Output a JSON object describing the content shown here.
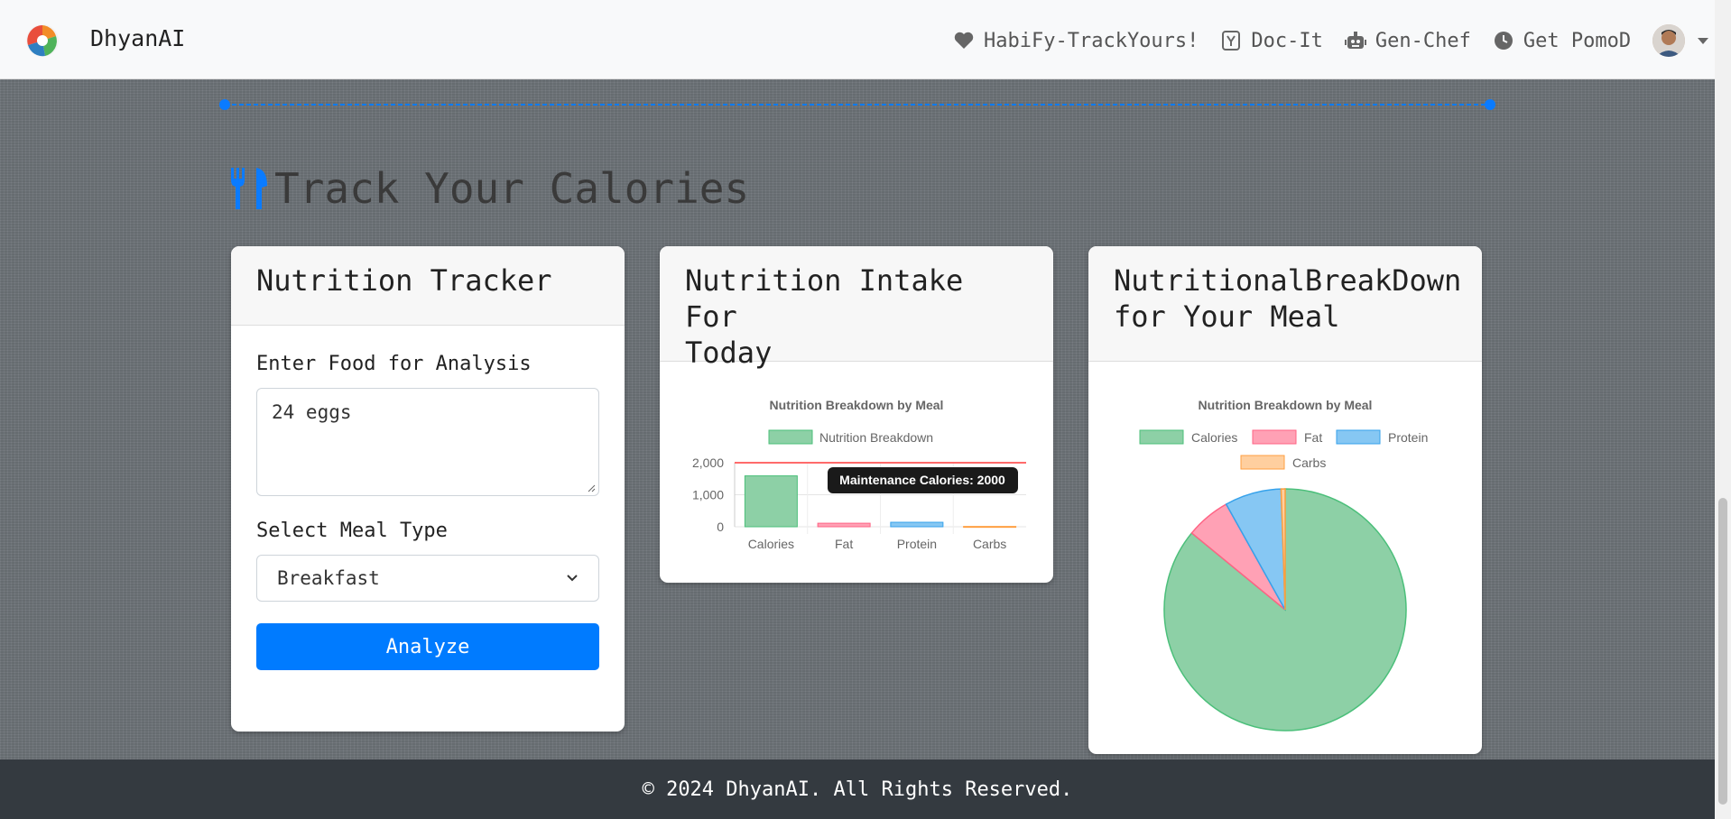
{
  "nav": {
    "brand": "DhyanAI",
    "items": [
      {
        "label": "HabiFy-TrackYours!",
        "icon": "heart-icon"
      },
      {
        "label": "Doc-It",
        "icon": "yahoo-icon"
      },
      {
        "label": "Gen-Chef",
        "icon": "robot-icon"
      },
      {
        "label": "Get PomoD",
        "icon": "clock-icon"
      }
    ]
  },
  "page": {
    "heading": "Track Your Calories"
  },
  "tracker": {
    "title": "Nutrition Tracker",
    "food_label": "Enter Food for Analysis",
    "food_value": "24 eggs",
    "meal_label": "Select Meal Type",
    "meal_value": "Breakfast",
    "analyze_label": "Analyze"
  },
  "intake_card": {
    "title_line1": "Nutrition Intake For",
    "title_line2": "Today"
  },
  "breakdown_card": {
    "title_line1": "NutritionalBreakDown",
    "title_line2": "for Your Meal"
  },
  "footer": {
    "text": "© 2024 DhyanAI. All Rights Reserved."
  },
  "colors": {
    "primary": "#007bff",
    "green": "#8dd0a6",
    "pink": "#ffa1b5",
    "blue": "#86c7f3",
    "orange": "#ffcf9f"
  },
  "chart_data": [
    {
      "type": "bar",
      "title": "Nutrition Breakdown by Meal",
      "categories": [
        "Calories",
        "Fat",
        "Protein",
        "Carbs"
      ],
      "series": [
        {
          "name": "Nutrition Breakdown",
          "values": [
            1590,
            110,
            140,
            10
          ]
        }
      ],
      "ylim": [
        0,
        2000
      ],
      "yticks": [
        "0",
        "1,000",
        "2,000"
      ],
      "annotation": {
        "value": 2000,
        "label": "Maintenance Calories: 2000"
      }
    },
    {
      "type": "pie",
      "title": "Nutrition Breakdown by Meal",
      "labels": [
        "Calories",
        "Fat",
        "Protein",
        "Carbs"
      ],
      "values": [
        1590,
        110,
        140,
        10
      ]
    }
  ]
}
